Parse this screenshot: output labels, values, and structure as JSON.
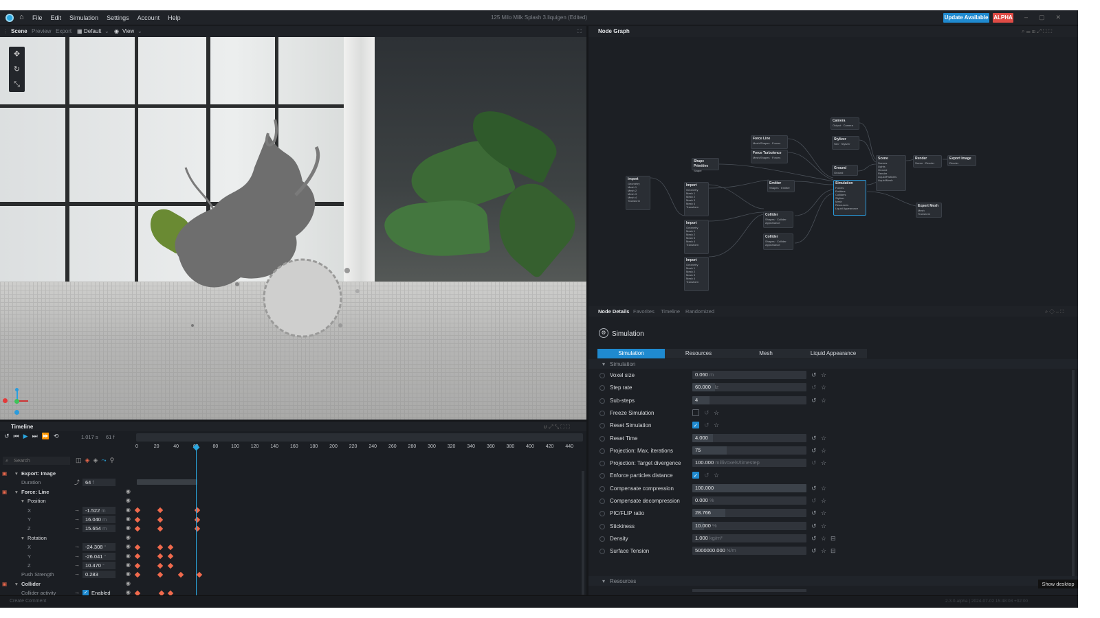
{
  "app": {
    "window_title": "125 Milo Milk Splash 3.liquigen",
    "window_status": "(Edited)",
    "menu": [
      "File",
      "Edit",
      "Simulation",
      "Settings",
      "Account",
      "Help"
    ],
    "update_label": "Update Available",
    "alpha_label": "ALPHA"
  },
  "scene": {
    "tabs": [
      "Scene",
      "Preview",
      "Export"
    ],
    "layout_label": "Default",
    "view_label": "View"
  },
  "node_graph": {
    "title": "Node Graph",
    "nodes": [
      {
        "title": "Camera",
        "ports": [
          "Output",
          "Camera"
        ]
      },
      {
        "title": "Force Line",
        "ports": [
          "Mesh/Shapes",
          "Forces"
        ]
      },
      {
        "title": "Force Turbulence",
        "ports": [
          "Mesh/Shapes",
          "Forces"
        ]
      },
      {
        "title": "Stylizer",
        "ports": [
          "Sim",
          "Stylizer"
        ]
      },
      {
        "title": "Shape Primitive",
        "ports": [
          "Shape"
        ]
      },
      {
        "title": "Ground",
        "ports": [
          "Ground"
        ]
      },
      {
        "title": "Scene",
        "ports": [
          "Scenes",
          "Lights",
          "Ground",
          "Render",
          "Liquid/Particles",
          "Liquid/Mesh"
        ]
      },
      {
        "title": "Render",
        "ports": [
          "Scene",
          "Render"
        ]
      },
      {
        "title": "Export Image",
        "ports": [
          "Render"
        ]
      },
      {
        "title": "Import",
        "ports": [
          "Geometry",
          "Mesh 1",
          "Mesh 2",
          "Mesh 3",
          "Mesh 4",
          "Transform"
        ]
      },
      {
        "title": "Import",
        "ports": [
          "Geometry",
          "Mesh 1",
          "Mesh 2",
          "Mesh 3",
          "Mesh 4",
          "Transform"
        ]
      },
      {
        "title": "Emitter",
        "ports": [
          "Shapes",
          "Emitter"
        ]
      },
      {
        "title": "Simulation",
        "ports": [
          "Forces",
          "Emitters",
          "Colliders",
          "Stylizer",
          "Mesh",
          "Resources",
          "Liquid Appearance"
        ]
      },
      {
        "title": "Export Mesh",
        "ports": [
          "Mesh",
          "Transform"
        ]
      },
      {
        "title": "Collider",
        "ports": [
          "Shapes",
          "Collider",
          "Appearance"
        ]
      },
      {
        "title": "Import",
        "ports": [
          "Geometry",
          "Mesh 1",
          "Mesh 2",
          "Mesh 3",
          "Mesh 4",
          "Transform"
        ]
      },
      {
        "title": "Collider",
        "ports": [
          "Shapes",
          "Collider",
          "Appearance"
        ]
      },
      {
        "title": "Import",
        "ports": [
          "Geometry",
          "Mesh 1",
          "Mesh 2",
          "Mesh 3",
          "Mesh 4",
          "Transform"
        ]
      }
    ]
  },
  "details": {
    "tabs": [
      "Node Details",
      "Favorites",
      "Timeline",
      "Randomized"
    ],
    "node_title": "Simulation",
    "sub_tabs": [
      "Simulation",
      "Resources",
      "Mesh",
      "Liquid Appearance"
    ],
    "section_simulation": "Simulation",
    "section_resources": "Resources",
    "props": [
      {
        "label": "Voxel size",
        "value": "0.060",
        "unit": "m",
        "fill": 0
      },
      {
        "label": "Step rate",
        "value": "60.000",
        "unit": "Hz",
        "fill": 0.2
      },
      {
        "label": "Sub-steps",
        "value": "4",
        "unit": "",
        "fill": 0.15
      },
      {
        "label": "Freeze Simulation",
        "checkbox": false
      },
      {
        "label": "Reset Simulation",
        "checkbox": true
      },
      {
        "label": "Reset Time",
        "value": "4.000",
        "unit": "s",
        "fill": 0.18
      },
      {
        "label": "Projection: Max. iterations",
        "value": "75",
        "unit": "",
        "fill": 0.3
      },
      {
        "label": "Projection: Target divergence",
        "value": "100.000",
        "unit": "millivoxels/timestep",
        "fill": 0
      },
      {
        "label": "Enforce particles distance",
        "checkbox": true
      },
      {
        "label": "Compensate compression",
        "value": "100.000",
        "unit": "%",
        "fill": 1
      },
      {
        "label": "Compensate decompression",
        "value": "0.000",
        "unit": "%",
        "fill": 0
      },
      {
        "label": "PIC/FLIP ratio",
        "value": "28.766",
        "unit": "%",
        "fill": 0.29
      },
      {
        "label": "Stickiness",
        "value": "10.000",
        "unit": "%",
        "fill": 0.1
      },
      {
        "label": "Density",
        "value": "1.000",
        "unit": "kg/m³",
        "fill": 0
      },
      {
        "label": "Surface Tension",
        "value": "5000000.000",
        "unit": "N/m",
        "fill": 0
      }
    ],
    "show_desktop": "Show desktop"
  },
  "timeline": {
    "title": "Timeline",
    "time_value": "1.017",
    "time_unit": "s",
    "frame_value": "61",
    "frame_unit": "f",
    "search_placeholder": "Search",
    "ticks": [
      "0",
      "20",
      "40",
      "60",
      "80",
      "100",
      "120",
      "140",
      "160",
      "180",
      "200",
      "220",
      "240",
      "260",
      "280",
      "300",
      "320",
      "340",
      "360",
      "380",
      "400",
      "420",
      "440"
    ],
    "tracks": [
      {
        "name": "Export: Image",
        "header": true
      },
      {
        "name": "Duration",
        "value": "64",
        "unit": "f",
        "sub": true
      },
      {
        "name": "Force: Line",
        "header": true
      },
      {
        "name": "Position",
        "group": true
      },
      {
        "name": "X",
        "value": "-1.522",
        "unit": "m"
      },
      {
        "name": "Y",
        "value": "16.040",
        "unit": "m"
      },
      {
        "name": "Z",
        "value": "15.654",
        "unit": "m"
      },
      {
        "name": "Rotation",
        "group": true
      },
      {
        "name": "X",
        "value": "-24.308",
        "unit": "°"
      },
      {
        "name": "Y",
        "value": "-26.041",
        "unit": "°"
      },
      {
        "name": "Z",
        "value": "10.470",
        "unit": "°"
      },
      {
        "name": "Push Strength",
        "value": "0.283",
        "unit": "",
        "sub": true
      },
      {
        "name": "Collider",
        "header": true
      },
      {
        "name": "Collider activity",
        "value": "Enabled",
        "unit": "",
        "sub": true
      }
    ],
    "create_comment": "Create Comment",
    "version": "2.3.0-alpha | 2024-07-02 15:48:08 +02:00"
  }
}
